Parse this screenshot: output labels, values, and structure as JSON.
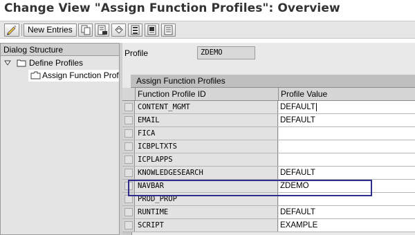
{
  "window": {
    "title": "Change View \"Assign Function Profiles\": Overview"
  },
  "toolbar": {
    "new_entries_label": "New Entries",
    "icons": [
      "edit-icon",
      "copy-icon",
      "delete-icon",
      "undo-icon",
      "select-all-icon",
      "select-block-icon",
      "deselect-all-icon"
    ]
  },
  "dialog_structure": {
    "header": "Dialog Structure",
    "items": [
      {
        "label": "Define Profiles",
        "expanded": true
      },
      {
        "label": "Assign Function Prof",
        "selected": true
      }
    ]
  },
  "profile": {
    "label": "Profile",
    "value": "ZDEMO"
  },
  "table": {
    "title": "Assign Function Profiles",
    "columns": [
      "Function Profile ID",
      "Profile Value"
    ],
    "rows": [
      {
        "id": "CONTENT_MGMT",
        "value": "DEFAULT"
      },
      {
        "id": "EMAIL",
        "value": "DEFAULT"
      },
      {
        "id": "FICA",
        "value": ""
      },
      {
        "id": "ICBPLTXTS",
        "value": ""
      },
      {
        "id": "ICPLAPPS",
        "value": ""
      },
      {
        "id": "KNOWLEDGESEARCH",
        "value": "DEFAULT"
      },
      {
        "id": "NAVBAR",
        "value": "ZDEMO"
      },
      {
        "id": "PROD_PROP",
        "value": ""
      },
      {
        "id": "RUNTIME",
        "value": "DEFAULT"
      },
      {
        "id": "SCRIPT",
        "value": "EXAMPLE"
      }
    ]
  },
  "colors": {
    "highlight_border": "#2e2e8a",
    "grid_bg": "#e9e9e9"
  }
}
